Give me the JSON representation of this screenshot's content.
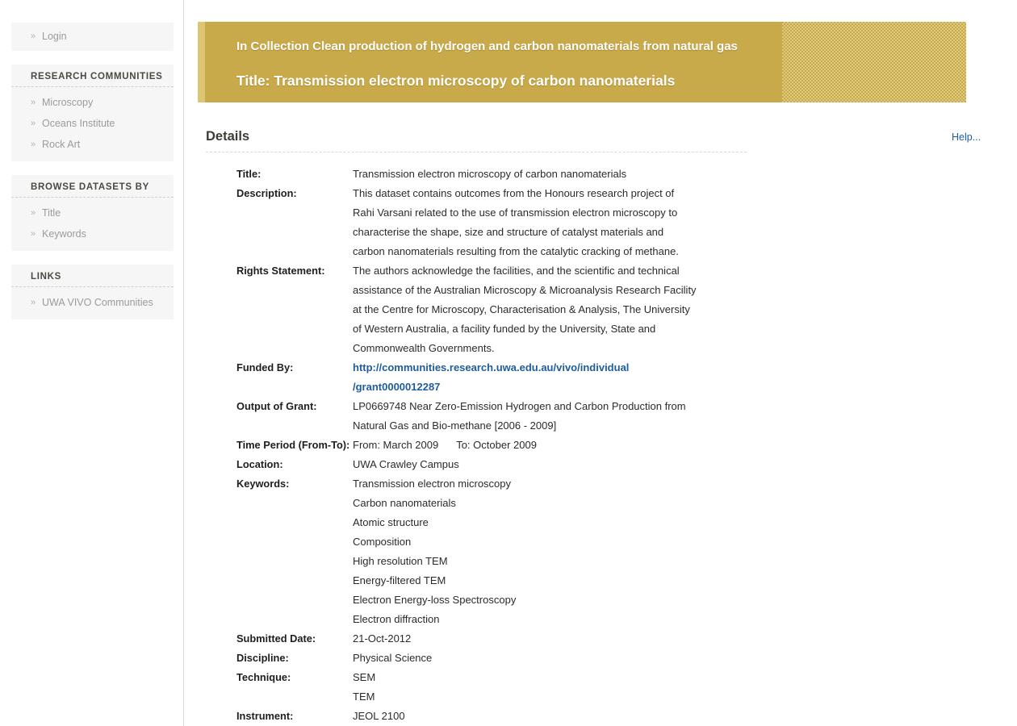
{
  "sidebar": {
    "login": {
      "label": "Login",
      "chevron_icon": "double-chevron-right"
    },
    "sections": [
      {
        "heading": "RESEARCH COMMUNITIES",
        "items": [
          {
            "label": "Microscopy"
          },
          {
            "label": "Oceans Institute"
          },
          {
            "label": "Rock Art"
          }
        ]
      },
      {
        "heading": "BROWSE DATASETS BY",
        "items": [
          {
            "label": "Title"
          },
          {
            "label": "Keywords"
          }
        ]
      },
      {
        "heading": "LINKS",
        "items": [
          {
            "label": "UWA VIVO Communities"
          }
        ]
      }
    ]
  },
  "banner": {
    "collection_line": "In Collection Clean production of hydrogen and carbon nanomaterials from natural gas",
    "title_line": "Title: Transmission electron microscopy of carbon nanomaterials",
    "background_color": "#c9aa4b",
    "accent_color": "#ddc571",
    "text_color": "#ffffff"
  },
  "details": {
    "heading": "Details",
    "help_label": "Help...",
    "link_color": "#1f5c9e",
    "rows": [
      {
        "label": "Title:",
        "lines": [
          "Transmission electron microscopy of carbon nanomaterials"
        ]
      },
      {
        "label": "Description:",
        "lines": [
          "This dataset contains outcomes from the Honours research project of",
          "Rahi Varsani related to the use of transmission electron microscopy to",
          "characterise the shape, size and structure of catalyst materials and",
          "carbon nanomaterials resulting from the catalytic cracking of methane."
        ]
      },
      {
        "label": "Rights Statement:",
        "lines": [
          "The authors acknowledge the facilities, and the scientific and technical",
          "assistance of the Australian Microscopy & Microanalysis Research Facility",
          "at the Centre for Microscopy, Characterisation & Analysis, The University",
          "of Western Australia, a facility funded by the University, State and",
          "Commonwealth Governments."
        ]
      },
      {
        "label": "Funded By:",
        "is_link": true,
        "lines": [
          "http://communities.research.uwa.edu.au/vivo/individual",
          "/grant0000012287"
        ]
      },
      {
        "label": "Output of Grant:",
        "lines": [
          "LP0669748 Near Zero-Emission Hydrogen and Carbon Production from",
          "Natural Gas and Bio-methane [2006 - 2009]"
        ]
      },
      {
        "label": "Time Period (From-To):",
        "time_period": {
          "from": "From: March 2009",
          "to": "To: October 2009"
        },
        "lines": []
      },
      {
        "label": "Location:",
        "lines": [
          "UWA Crawley Campus"
        ]
      },
      {
        "label": "Keywords:",
        "lines": [
          "Transmission electron microscopy",
          "Carbon nanomaterials",
          "Atomic structure",
          "Composition",
          "High resolution TEM",
          "Energy-filtered TEM",
          "Electron Energy-loss Spectroscopy",
          "Electron diffraction"
        ]
      },
      {
        "label": "Submitted Date:",
        "lines": [
          "21-Oct-2012"
        ]
      },
      {
        "label": "Discipline:",
        "lines": [
          "Physical Science"
        ]
      },
      {
        "label": "Technique:",
        "lines": [
          "SEM",
          "TEM"
        ]
      },
      {
        "label": "Instrument:",
        "lines": [
          "JEOL 2100"
        ]
      }
    ]
  }
}
